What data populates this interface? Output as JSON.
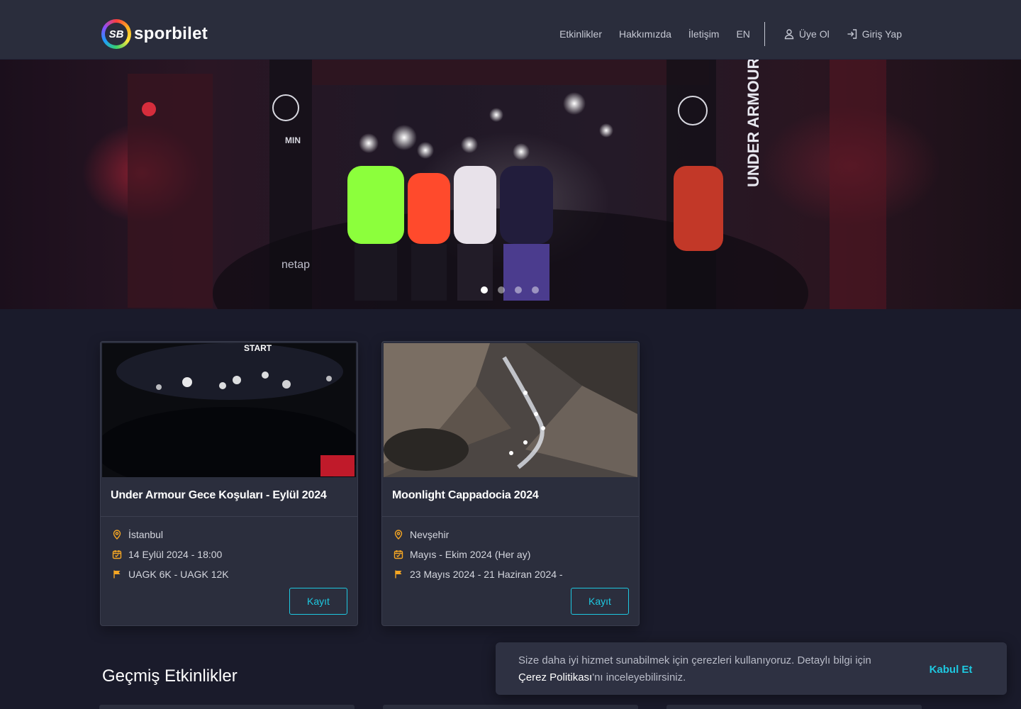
{
  "header": {
    "brand_mark": "SB",
    "brand_name": "sporbilet",
    "nav": {
      "events": "Etkinlikler",
      "about": "Hakkımızda",
      "contact": "İletişim",
      "language": "EN",
      "signup": "Üye Ol",
      "login": "Giriş Yap"
    },
    "icons": {
      "signup": "user-icon",
      "login": "login-arrow-icon"
    }
  },
  "hero": {
    "slide_count": 4,
    "active_slide": 1,
    "banner_texts": [
      "START",
      "netap",
      "MIN",
      "UNDER ARMOUR"
    ]
  },
  "events": [
    {
      "title": "Under Armour Gece Koşuları - Eylül 2024",
      "image_banner": "START",
      "location": "İstanbul",
      "date": "14 Eylül 2024 - 18:00",
      "categories": "UAGK 6K - UAGK 12K",
      "button": "Kayıt"
    },
    {
      "title": "Moonlight Cappadocia 2024",
      "location": "Nevşehir",
      "date": "Mayıs - Ekim 2024 (Her ay)",
      "categories": "23 Mayıs 2024 - 21 Haziran 2024 -",
      "button": "Kayıt"
    }
  ],
  "past_events": {
    "title": "Geçmiş Etkinlikler"
  },
  "cookie_banner": {
    "text_before": "Size daha iyi hizmet sunabilmek için çerezleri kullanıyoruz. Detaylı bilgi için ",
    "link": "Çerez Politikası",
    "text_after": "'nı inceleyebilirsiniz.",
    "accept": "Kabul Et"
  },
  "colors": {
    "page_bg": "#1a1b2b",
    "navbar_bg": "#2a2d3c",
    "card_bg": "#2b2e3d",
    "accent_cyan": "#1ec8e0",
    "meta_icon_orange": "#f5a623"
  }
}
